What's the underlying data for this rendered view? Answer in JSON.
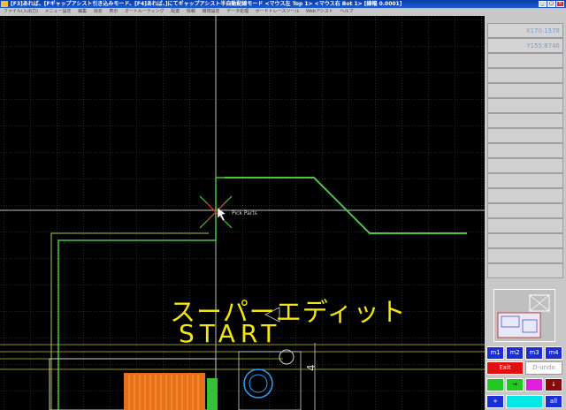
{
  "window": {
    "title": "[F3]あれば、[Fギャップアシスト引き込みモード、[F4]あれば、]にてギャップアシスト半自動配線モード <マウス左 Top 1> <マウス右 Bot 1> [線幅 0.0001]",
    "minimize": "_",
    "maximize": "□",
    "close": "×"
  },
  "menu": [
    "ファイル(入出力)",
    "メニュー設定",
    "編集",
    "消去",
    "表示",
    "オートルーティング",
    "配置",
    "情報",
    "環境設定",
    "データ処理",
    "ボードトレースツール",
    "Webアシスト",
    "ヘルプ"
  ],
  "panel": {
    "x_coord": "X170.1578",
    "y_coord": "Y155.6746",
    "buttons": {
      "m1": "m1",
      "m2": "m2",
      "m3": "m3",
      "m4": "m4",
      "exit": "Exit",
      "d_undo": "D-undo",
      "arrow_right": "→",
      "arrow_down": "↓",
      "plus": "+",
      "all": "all"
    }
  },
  "canvas": {
    "cursor_label": "Pick Parts",
    "overlay_line1": "スーパーエディット",
    "overlay_line2": "START"
  },
  "colors": {
    "grid": "#5a5a5a",
    "trace_green": "#49c83a",
    "crosshair": "#bfbfbf",
    "overlay_text": "#f5e60a",
    "pad_orange": "#e8701a"
  }
}
